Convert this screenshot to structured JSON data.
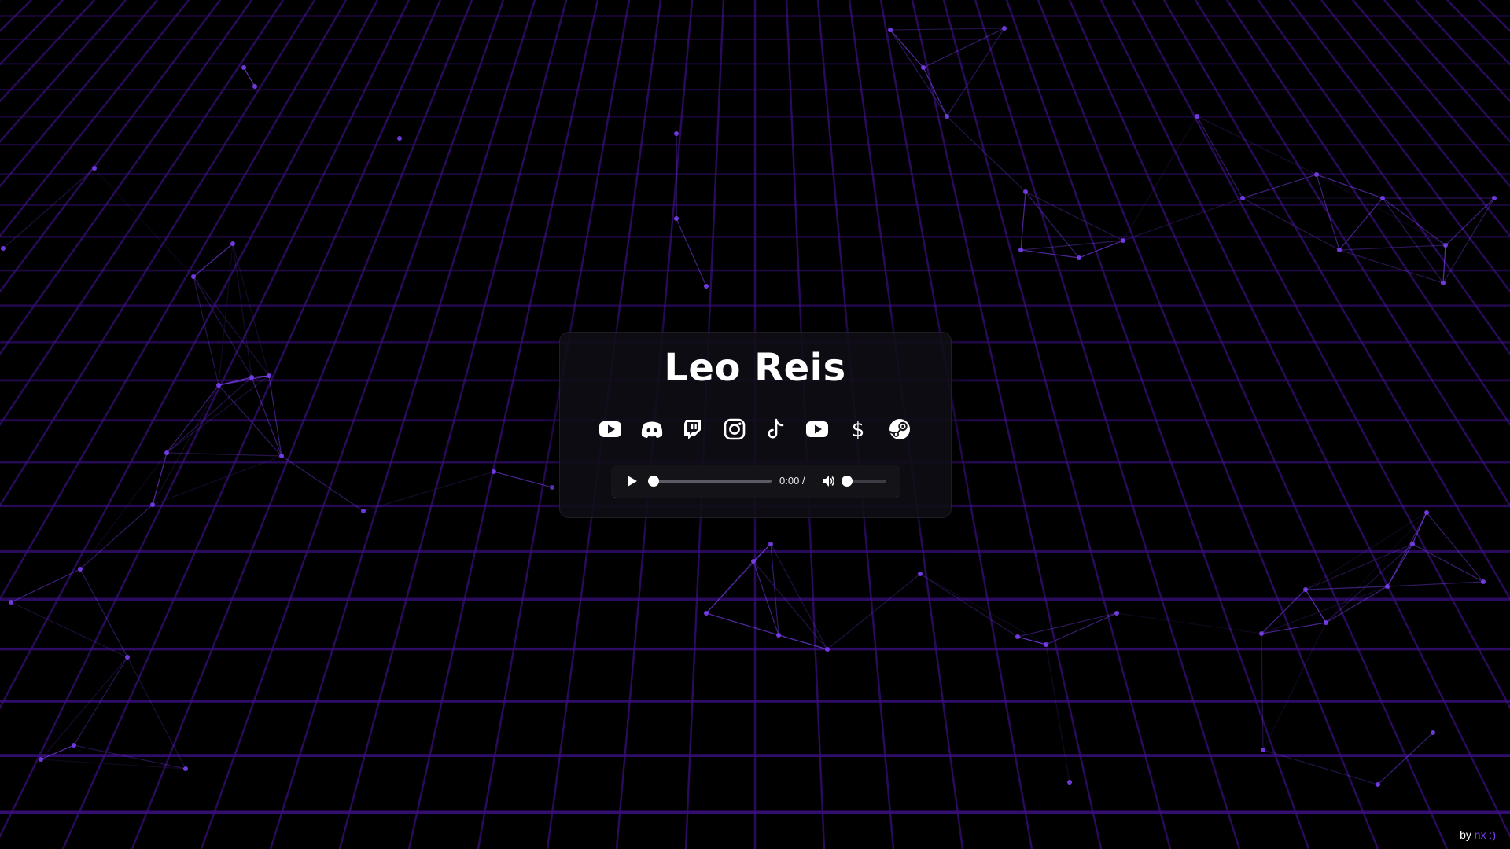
{
  "profile": {
    "name": "Leo Reis"
  },
  "socials": [
    {
      "icon": "youtube-icon",
      "label": "YouTube"
    },
    {
      "icon": "discord-icon",
      "label": "Discord"
    },
    {
      "icon": "twitch-icon",
      "label": "Twitch"
    },
    {
      "icon": "instagram-icon",
      "label": "Instagram"
    },
    {
      "icon": "tiktok-icon",
      "label": "TikTok"
    },
    {
      "icon": "youtube-icon",
      "label": "YouTube"
    },
    {
      "icon": "dollar-icon",
      "label": "Donate"
    },
    {
      "icon": "steam-icon",
      "label": "Steam"
    }
  ],
  "player": {
    "time": "0:00 /",
    "progress": 0,
    "volume": 0,
    "play_icon": "play-icon",
    "volume_icon": "volume-icon"
  },
  "footer": {
    "by": "by",
    "author": "nx :)"
  },
  "colors": {
    "accent": "#7b3ff2",
    "grid": "#3a0f80",
    "background": "#000000"
  }
}
